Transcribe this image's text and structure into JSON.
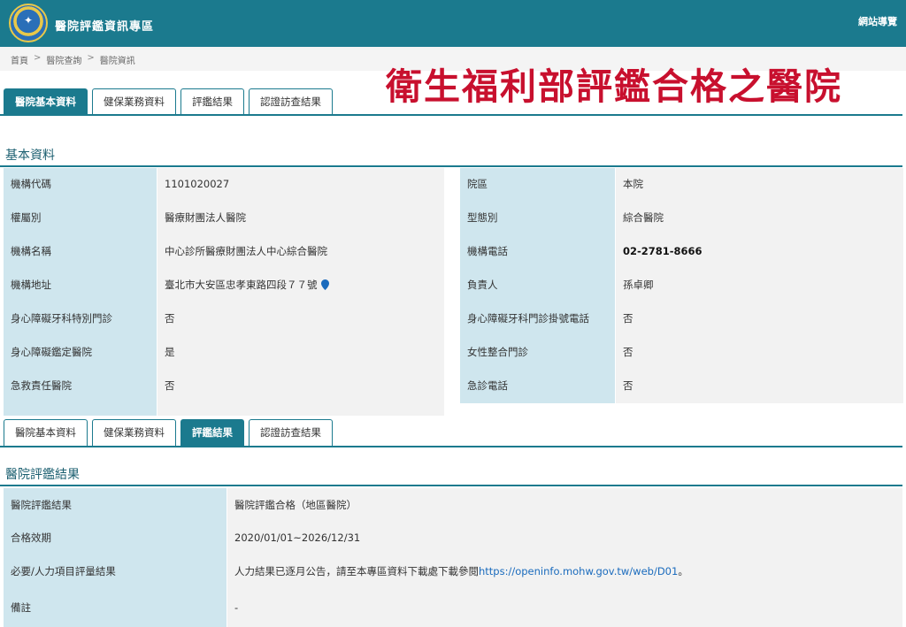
{
  "header": {
    "site_title": "醫院評鑑資訊專區",
    "sitemap": "網站導覽"
  },
  "breadcrumb": [
    "首頁",
    "醫院查詢",
    "醫院資訊"
  ],
  "overlay_title": "衛生福利部評鑑合格之醫院",
  "tabs": [
    "醫院基本資料",
    "健保業務資料",
    "評鑑結果",
    "認證訪查結果"
  ],
  "tabs_top_active": 0,
  "tabs_bottom_active": 2,
  "basic": {
    "title": "基本資料",
    "left": [
      {
        "label": "機構代碼",
        "value": "1101020027"
      },
      {
        "label": "權屬別",
        "value": "醫療財團法人醫院"
      },
      {
        "label": "機構名稱",
        "value": "中心診所醫療財團法人中心綜合醫院"
      },
      {
        "label": "機構地址",
        "value": "臺北市大安區忠孝東路四段７７號"
      },
      {
        "label": "身心障礙牙科特別門診",
        "value": "否"
      },
      {
        "label": "身心障礙鑑定醫院",
        "value": "是"
      },
      {
        "label": "急救責任醫院",
        "value": "否"
      }
    ],
    "right": [
      {
        "label": "院區",
        "value": "本院"
      },
      {
        "label": "型態別",
        "value": "綜合醫院"
      },
      {
        "label": "機構電話",
        "value": "02-2781-8666"
      },
      {
        "label": "負責人",
        "value": "孫卓卿"
      },
      {
        "label": "身心障礙牙科門診掛號電話",
        "value": "否"
      },
      {
        "label": "女性整合門診",
        "value": "否"
      },
      {
        "label": "急診電話",
        "value": "否"
      }
    ]
  },
  "evaluation": {
    "title": "醫院評鑑結果",
    "rows": [
      {
        "label": "醫院評鑑結果",
        "value": "醫院評鑑合格（地區醫院）"
      },
      {
        "label": "合格效期",
        "value": "2020/01/01~2026/12/31"
      },
      {
        "label": "必要/人力項目評量結果",
        "value": "人力結果已逐月公告，請至本專區資料下載處下載參閱",
        "link": "https://openinfo.mohw.gov.tw/web/D01",
        "suffix": "。"
      },
      {
        "label": "備註",
        "value": "-"
      }
    ]
  },
  "colors": {
    "brand": "#1b7a8e",
    "label_bg": "#cfe6ee",
    "value_bg": "#f2f2f2",
    "overlay": "#c8102e",
    "link": "#1a6bbd"
  }
}
